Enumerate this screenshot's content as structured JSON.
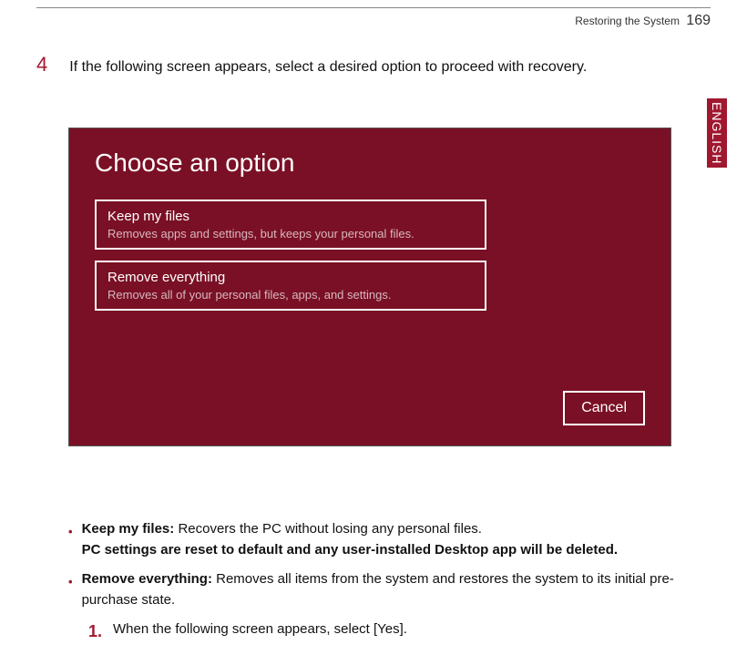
{
  "header": {
    "section": "Restoring the System",
    "page": "169"
  },
  "sidebar": {
    "language": "ENGLISH"
  },
  "step": {
    "number": "4",
    "text": "If the following screen appears, select a desired option to proceed with recovery."
  },
  "screenshot": {
    "title": "Choose an option",
    "option1": {
      "title": "Keep my files",
      "desc": "Removes apps and settings, but keeps your personal files."
    },
    "option2": {
      "title": "Remove everything",
      "desc": "Removes all of your personal files, apps, and settings."
    },
    "cancel": "Cancel"
  },
  "explain": {
    "keep_bold": "Keep my files:",
    "keep_text": " Recovers the PC without losing any personal files.",
    "keep_line2": "PC settings are reset to default and any user-installed Desktop app will be deleted.",
    "remove_bold": "Remove everything:",
    "remove_text": " Removes all items from the system and restores the system to its initial pre-purchase state.",
    "substep_num": "1.",
    "substep_text": "When the following screen appears, select [Yes]."
  }
}
